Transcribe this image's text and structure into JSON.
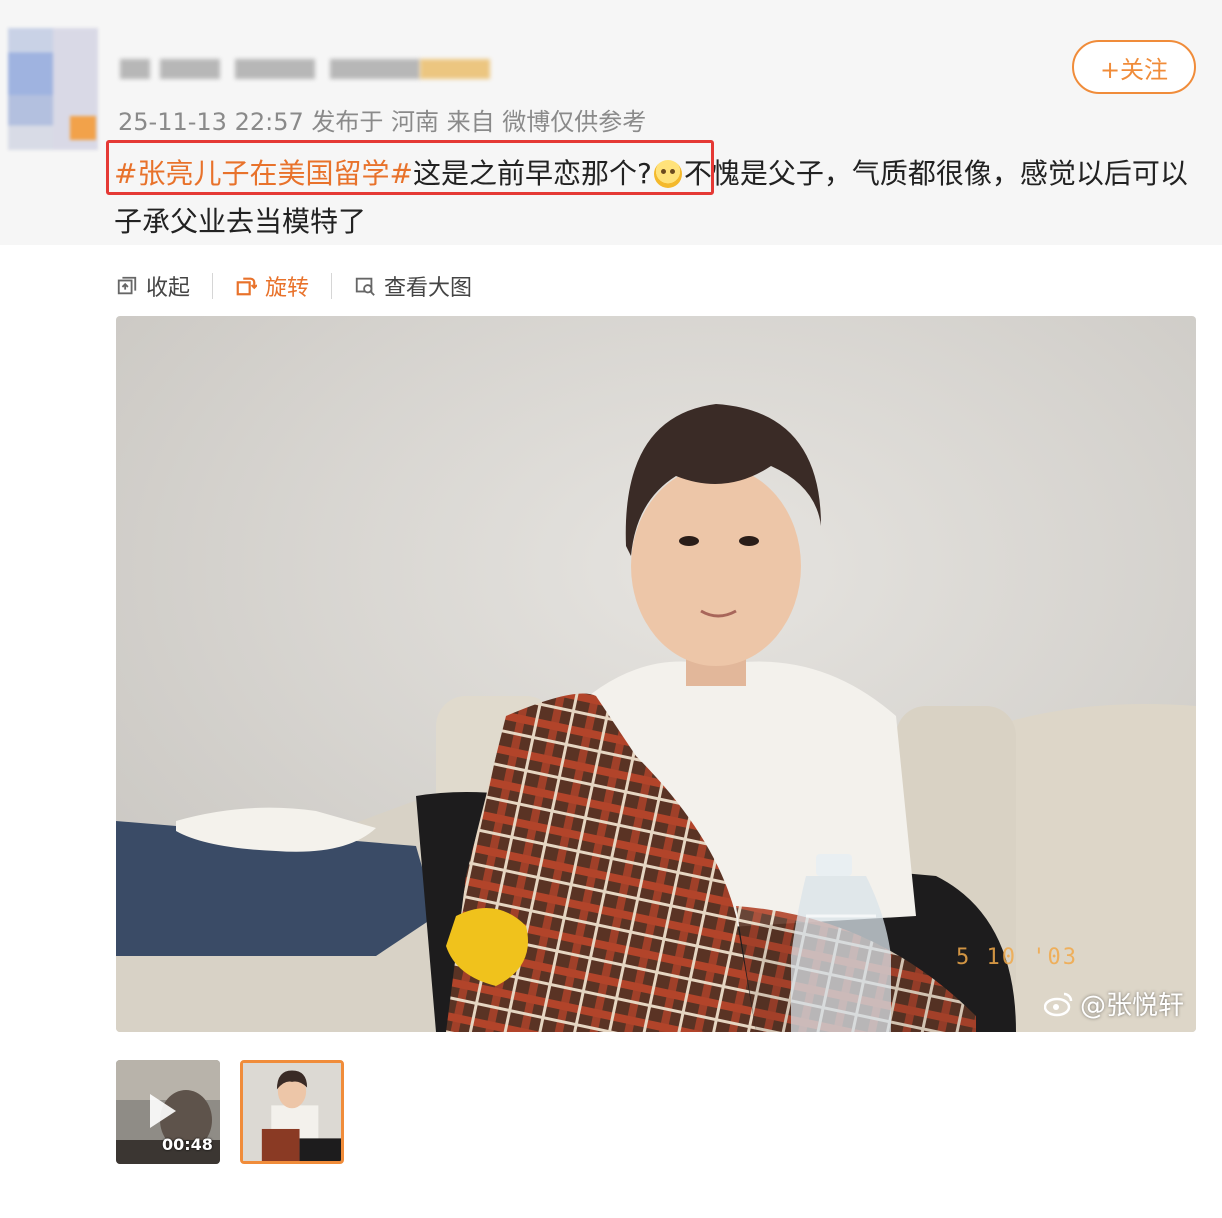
{
  "post": {
    "meta": "25-11-13 22:57  发布于 河南  来自 微博仅供参考",
    "follow_label": "+关注",
    "hashtag": "#张亮儿子在美国留学#",
    "text_part1": "这是之前早恋那个?",
    "text_part2": "不愧是父子，气质都很像，感觉以后可以子承父业去当模特了",
    "emoji_icon": "thinking-face-icon"
  },
  "toolbar": {
    "collapse_label": "收起",
    "rotate_label": "旋转",
    "view_large_label": "查看大图"
  },
  "photo": {
    "date_stamp": "5 10 '03",
    "watermark": "@张悦轩"
  },
  "thumbnails": {
    "video_duration": "00:48"
  },
  "colors": {
    "accent": "#f08c3a",
    "hashtag": "#e8722b",
    "highlight_border": "#e53935",
    "meta_text": "#8a8a8a"
  }
}
